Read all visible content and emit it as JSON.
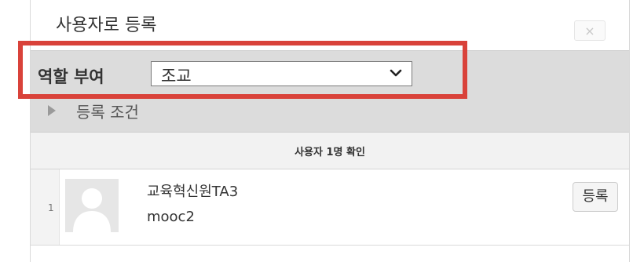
{
  "dialog": {
    "title": "사용자로 등록",
    "close_label": "×"
  },
  "enrol_options": {
    "role_label": "역할 부여",
    "role_selected": "조교",
    "enrol_conditions_label": "등록 조건"
  },
  "results": {
    "count_text": "사용자 1명 확인",
    "users": [
      {
        "index": "1",
        "name": "교육혁신원TA3",
        "id": "mooc2",
        "enrol_label": "등록"
      }
    ]
  },
  "colors": {
    "highlight": "#d9423a",
    "panel_bg": "#dcdcdc",
    "header_bg": "#f2f2f2"
  },
  "icons": {
    "dropdown": "chevron-down-icon",
    "expand": "triangle-right-icon",
    "avatar": "default-user-icon"
  }
}
